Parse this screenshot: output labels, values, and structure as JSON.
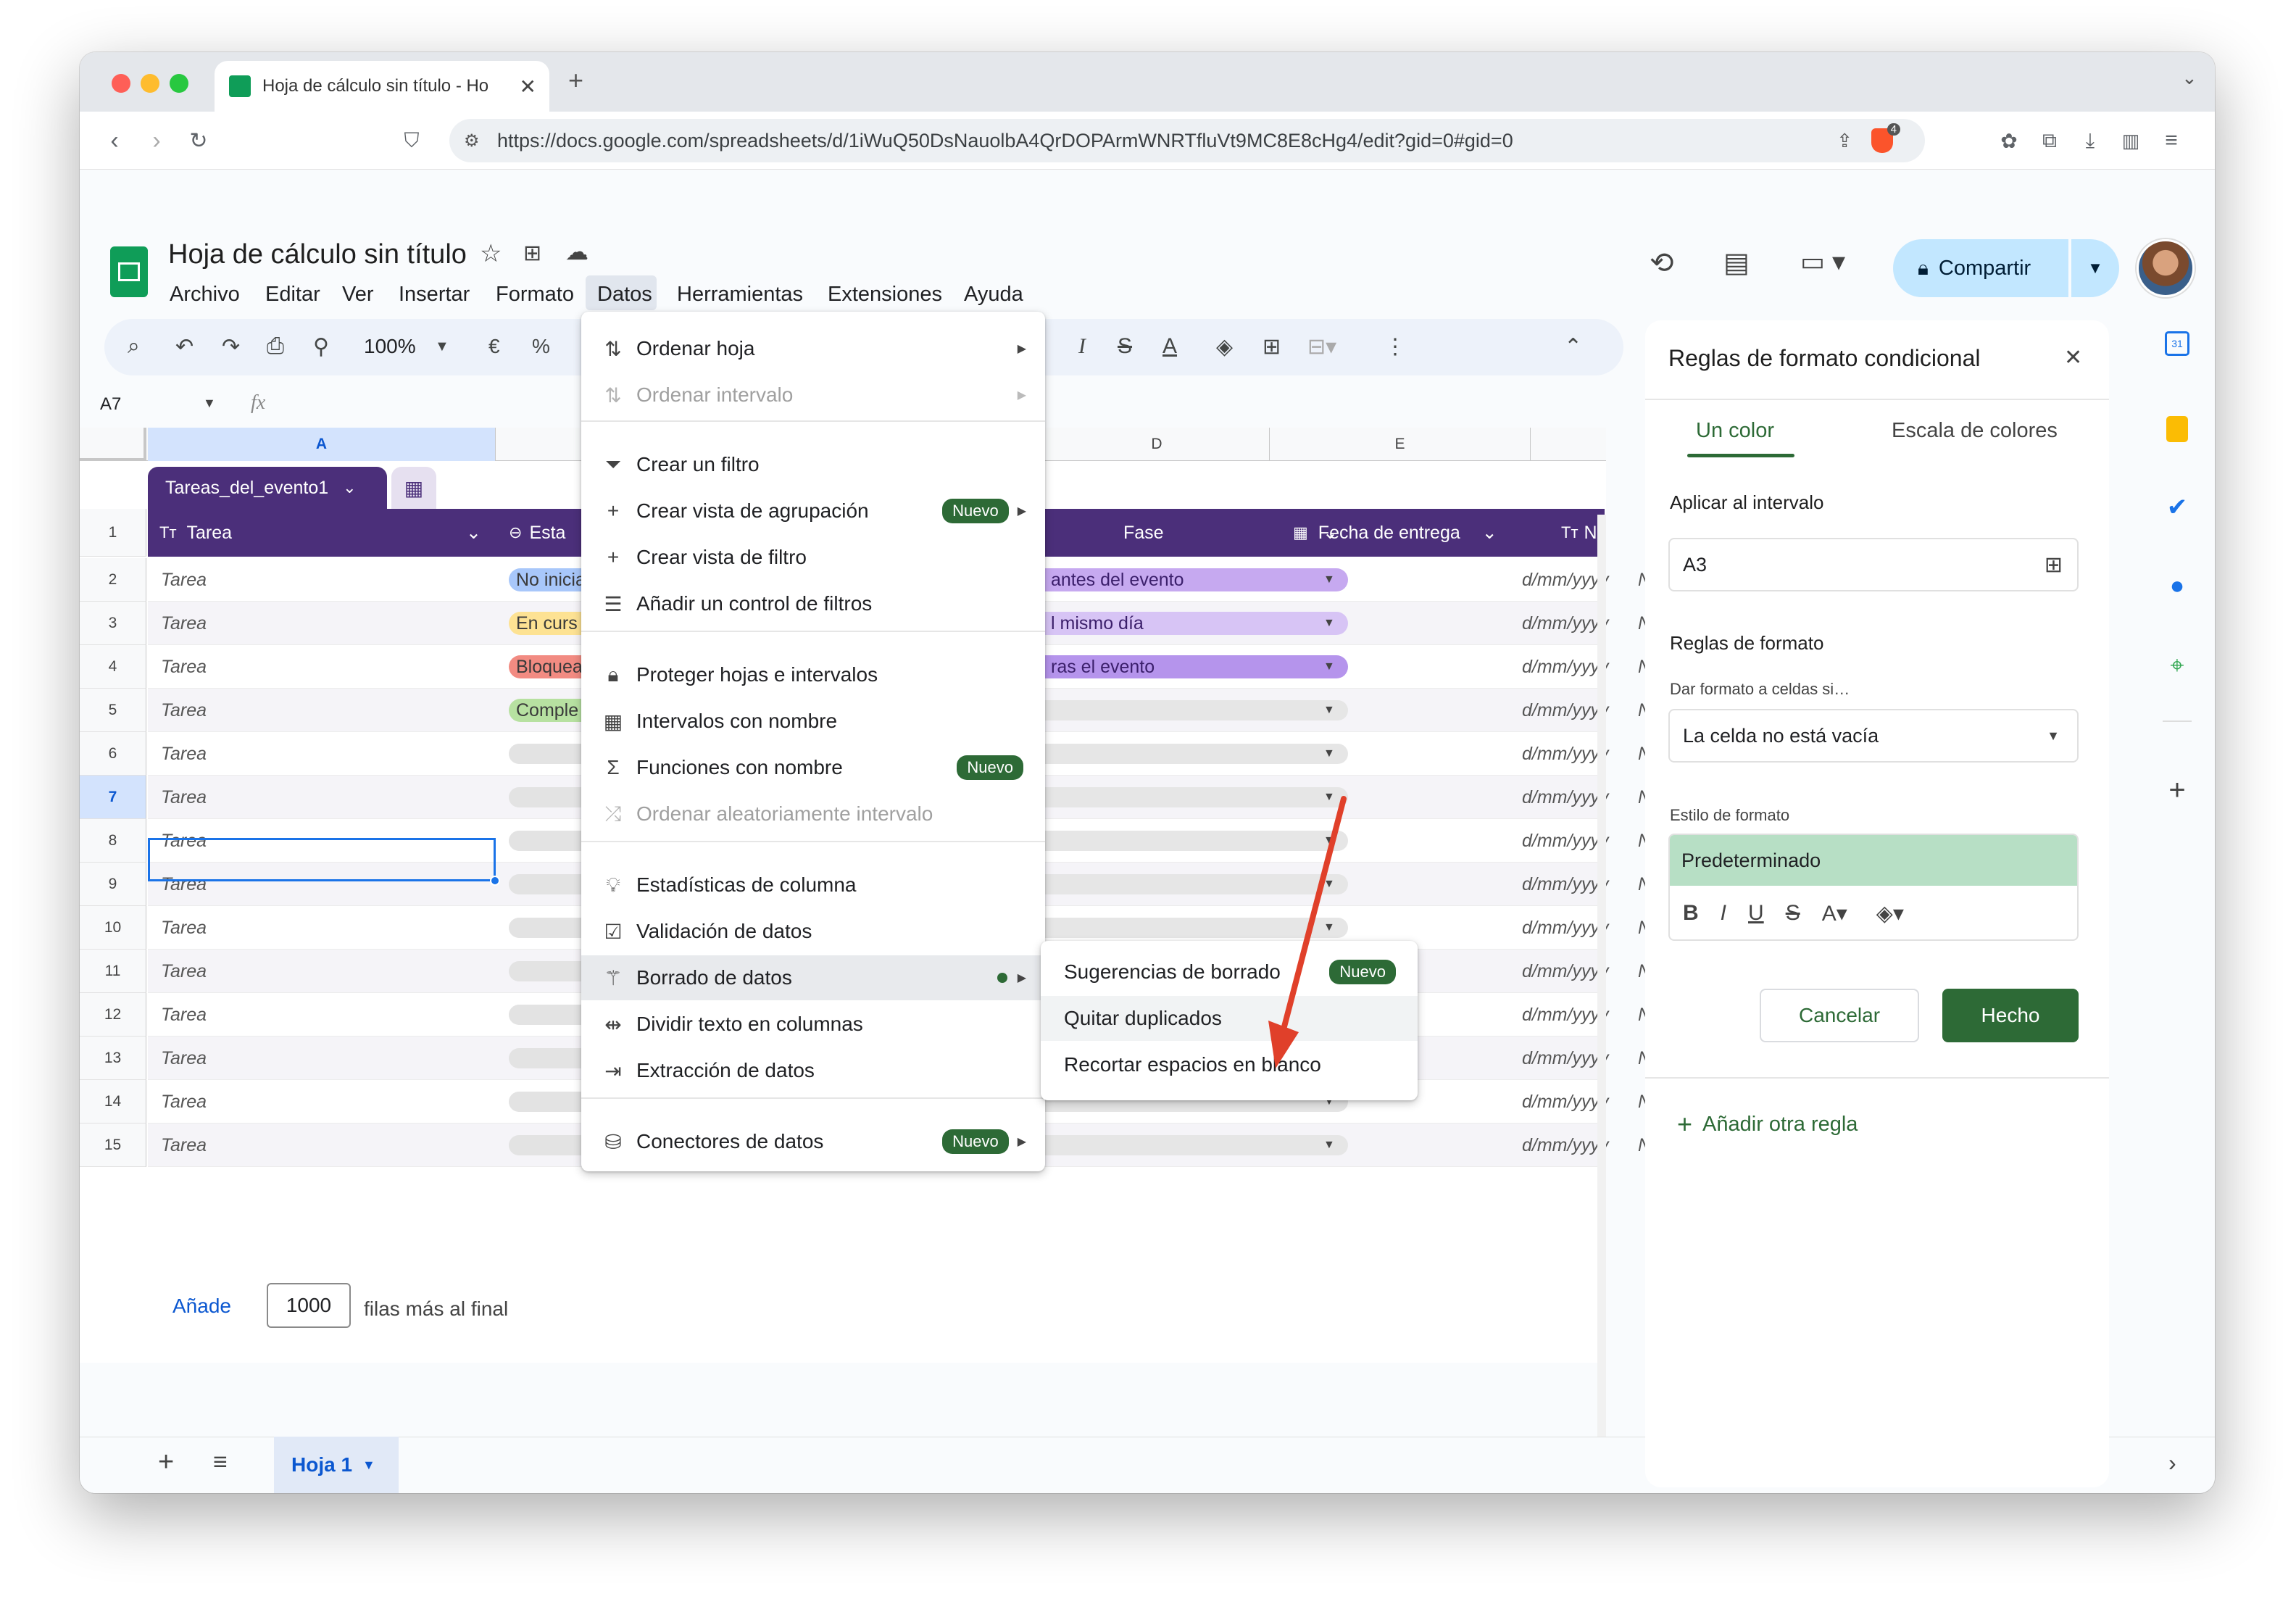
{
  "browser": {
    "tab_title": "Hoja de cálculo sin título - Ho",
    "url": "https://docs.google.com/spreadsheets/d/1iWuQ50DsNauolbA4QrDOPArmWNRTfluVt9MC8E8cHg4/edit?gid=0#gid=0",
    "brave_badge": "4"
  },
  "doc": {
    "title": "Hoja de cálculo sin título",
    "menus": [
      "Archivo",
      "Editar",
      "Ver",
      "Insertar",
      "Formato",
      "Datos",
      "Herramientas",
      "Extensiones",
      "Ayuda"
    ],
    "share_label": "Compartir"
  },
  "toolbar": {
    "zoom": "100%",
    "currency": "€",
    "percent": "%"
  },
  "formula_bar": {
    "cell_ref": "A7",
    "fx": "fx"
  },
  "grid": {
    "columns": [
      "A",
      "D",
      "E"
    ],
    "table_name": "Tareas_del_evento1",
    "headers": {
      "tarea": "Tarea",
      "estado": "Esta",
      "fase": "Fase",
      "fecha": "Fecha de entrega",
      "notas": "N"
    },
    "row_numbers": [
      "1",
      "2",
      "3",
      "4",
      "5",
      "6",
      "7",
      "8",
      "9",
      "10",
      "11",
      "12",
      "13",
      "14",
      "15"
    ],
    "task_value": "Tarea",
    "date_value": "d/mm/yyyy",
    "notes_value": "Notas",
    "status": [
      "No inicia",
      "En curs",
      "Bloquea",
      "Comple"
    ],
    "phase": [
      "antes del evento",
      "l mismo día",
      "ras el evento"
    ],
    "add_rows": {
      "link": "Añade",
      "count": "1000",
      "suffix": "filas más al final"
    }
  },
  "sheet_tabs": {
    "active": "Hoja 1"
  },
  "datos_menu": {
    "items": [
      {
        "label": "Ordenar hoja",
        "icon": "sort-icon",
        "disabled": false
      },
      {
        "label": "Ordenar intervalo",
        "icon": "sort-icon",
        "disabled": true
      },
      {
        "label": "Crear un filtro",
        "icon": "filter-icon",
        "disabled": false
      },
      {
        "label": "Crear vista de agrupación",
        "icon": "plus-icon",
        "badge": "Nuevo",
        "disabled": false
      },
      {
        "label": "Crear vista de filtro",
        "icon": "plus-icon",
        "disabled": false
      },
      {
        "label": "Añadir un control de filtros",
        "icon": "filter-lines-icon",
        "disabled": false
      },
      {
        "label": "Proteger hojas e intervalos",
        "icon": "lock-icon",
        "disabled": false
      },
      {
        "label": "Intervalos con nombre",
        "icon": "table-icon",
        "disabled": false
      },
      {
        "label": "Funciones con nombre",
        "icon": "sigma-icon",
        "badge": "Nuevo",
        "disabled": false
      },
      {
        "label": "Ordenar aleatoriamente intervalo",
        "icon": "shuffle-icon",
        "disabled": true
      },
      {
        "label": "Estadísticas de columna",
        "icon": "lightbulb-icon",
        "disabled": false
      },
      {
        "label": "Validación de datos",
        "icon": "validation-icon",
        "disabled": false
      },
      {
        "label": "Borrado de datos",
        "icon": "magic-wand-icon",
        "disabled": false
      },
      {
        "label": "Dividir texto en columnas",
        "icon": "split-icon",
        "disabled": false
      },
      {
        "label": "Extracción de datos",
        "icon": "extract-icon",
        "disabled": false
      },
      {
        "label": "Conectores de datos",
        "icon": "database-icon",
        "badge": "Nuevo",
        "disabled": false
      }
    ]
  },
  "submenu": {
    "items": [
      {
        "label": "Sugerencias de borrado",
        "badge": "Nuevo"
      },
      {
        "label": "Quitar duplicados"
      },
      {
        "label": "Recortar espacios en blanco"
      }
    ]
  },
  "cf_panel": {
    "title": "Reglas de formato condicional",
    "tabs": [
      "Un color",
      "Escala de colores"
    ],
    "apply_label": "Aplicar al intervalo",
    "range": "A3",
    "rules_label": "Reglas de formato",
    "condition_label": "Dar formato a celdas si…",
    "condition_value": "La celda no está vacía",
    "style_label": "Estilo de formato",
    "style_preview": "Predeterminado",
    "cancel": "Cancelar",
    "done": "Hecho",
    "add_rule": "Añadir otra regla"
  },
  "colors": {
    "accent_green": "#2d6a36",
    "table_header": "#4b2f7a",
    "share_bg": "#c2e7ff",
    "arrow": "#e0402a"
  }
}
